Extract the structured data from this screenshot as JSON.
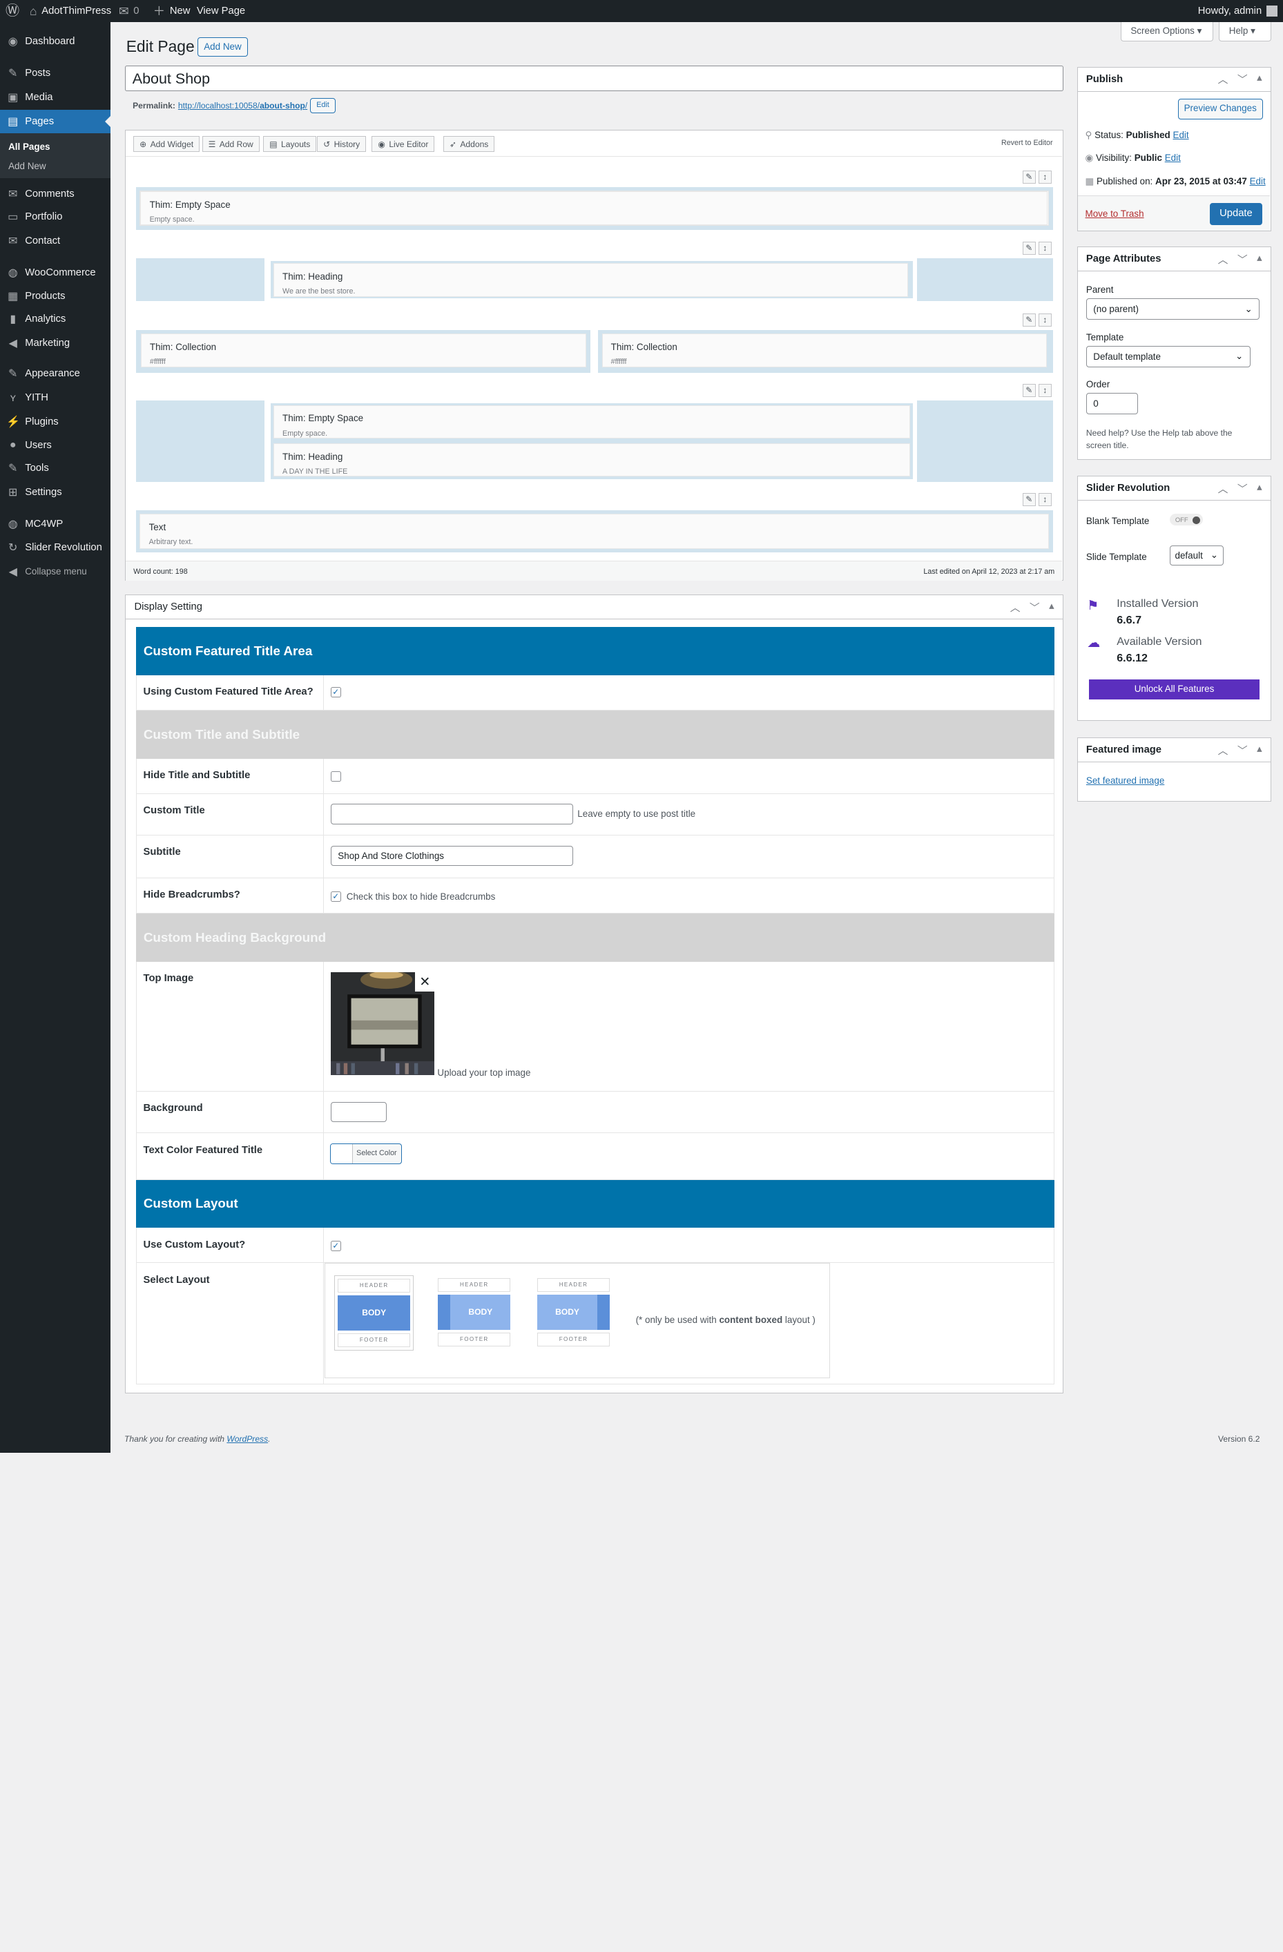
{
  "adminbar": {
    "site": "AdotThimPress",
    "comments": "0",
    "new": "New",
    "view": "View Page",
    "howdy": "Howdy, admin"
  },
  "menu": {
    "items": [
      {
        "label": "Dashboard",
        "icon": "dashboard-icon",
        "glyph": "◉"
      },
      {
        "label": "Posts",
        "icon": "pin-icon",
        "glyph": "✎"
      },
      {
        "label": "Media",
        "icon": "media-icon",
        "glyph": "▣"
      },
      {
        "label": "Pages",
        "icon": "page-icon",
        "glyph": "▤"
      },
      {
        "label": "Comments",
        "icon": "comment-icon",
        "glyph": "✉"
      },
      {
        "label": "Portfolio",
        "icon": "folder-icon",
        "glyph": "▭"
      },
      {
        "label": "Contact",
        "icon": "mail-icon",
        "glyph": "✉"
      },
      {
        "label": "WooCommerce",
        "icon": "woo-icon",
        "glyph": "◍"
      },
      {
        "label": "Products",
        "icon": "archive-icon",
        "glyph": "▦"
      },
      {
        "label": "Analytics",
        "icon": "chart-bar-icon",
        "glyph": "▮"
      },
      {
        "label": "Marketing",
        "icon": "megaphone-icon",
        "glyph": "◀"
      },
      {
        "label": "Appearance",
        "icon": "brush-icon",
        "glyph": "✎"
      },
      {
        "label": "YITH",
        "icon": "yith-icon",
        "glyph": "ʏ"
      },
      {
        "label": "Plugins",
        "icon": "plug-icon",
        "glyph": "⚡"
      },
      {
        "label": "Users",
        "icon": "user-icon",
        "glyph": "●"
      },
      {
        "label": "Tools",
        "icon": "wrench-icon",
        "glyph": "✎"
      },
      {
        "label": "Settings",
        "icon": "settings-icon",
        "glyph": "⊞"
      },
      {
        "label": "MC4WP",
        "icon": "mc4wp-icon",
        "glyph": "◍"
      },
      {
        "label": "Slider Revolution",
        "icon": "slider-icon",
        "glyph": "↻"
      },
      {
        "label": "Collapse menu",
        "icon": "collapse-icon",
        "glyph": "◀"
      }
    ],
    "sub": [
      "All Pages",
      "Add New"
    ]
  },
  "top": {
    "screen_options": "Screen Options ▾",
    "help": "Help ▾"
  },
  "page": {
    "heading": "Edit Page",
    "add_new": "Add New",
    "title": "About Shop",
    "permalink_label": "Permalink:",
    "permalink_base": "http://localhost:10058/",
    "permalink_slug": "about-shop",
    "permalink_end": "/",
    "edit": "Edit"
  },
  "builder": {
    "tools": [
      "Add Widget",
      "Add Row",
      "Layouts",
      "History",
      "Live Editor",
      "Addons"
    ],
    "revert": "Revert to Editor",
    "widgets": [
      {
        "title": "Thim: Empty Space",
        "desc": "Empty space."
      },
      {
        "title": "Thim: Heading",
        "desc": "We are the best store."
      },
      {
        "title": "Thim: Collection",
        "desc": "#ffffff"
      },
      {
        "title": "Thim: Collection",
        "desc": "#ffffff"
      },
      {
        "title": "Thim: Empty Space",
        "desc": "Empty space."
      },
      {
        "title": "Thim: Heading",
        "desc": "A DAY IN THE LIFE"
      },
      {
        "title": "Text",
        "desc": "Arbitrary text."
      }
    ],
    "word_count": "Word count: 198",
    "last_edited": "Last edited on April 12, 2023 at 2:17 am"
  },
  "display": {
    "title": "Display Setting",
    "sec1": "Custom Featured Title Area",
    "use_custom": "Using Custom Featured Title Area?",
    "sec2": "Custom Title and Subtitle",
    "hide_title": "Hide Title and Subtitle",
    "custom_title": "Custom Title",
    "custom_title_hint": "Leave empty to use post title",
    "custom_title_value": "",
    "subtitle": "Subtitle",
    "subtitle_value": "Shop And Store Clothings",
    "hide_bc": "Hide Breadcrumbs?",
    "hide_bc_hint": "Check this box to hide Breadcrumbs",
    "sec3": "Custom Heading Background",
    "top_image": "Top Image",
    "upload_hint": "Upload your top image",
    "background": "Background",
    "text_color": "Text Color Featured Title",
    "select_color": "Select Color",
    "sec4": "Custom Layout",
    "use_layout": "Use Custom Layout?",
    "select_layout": "Select Layout",
    "layout_header": "HEADER",
    "layout_body": "BODY",
    "layout_footer": "FOOTER",
    "layout_note_a": "(* only be used with ",
    "layout_note_b": "content boxed",
    "layout_note_c": " layout )"
  },
  "publish": {
    "title": "Publish",
    "preview": "Preview Changes",
    "status_label": "Status: ",
    "status": "Published",
    "visibility_label": "Visibility: ",
    "visibility": "Public",
    "published_label": "Published on: ",
    "published": "Apr 23, 2015 at 03:47",
    "edit": "Edit",
    "trash": "Move to Trash",
    "update": "Update"
  },
  "attrs": {
    "title": "Page Attributes",
    "parent_label": "Parent",
    "parent": "(no parent)",
    "template_label": "Template",
    "template": "Default template",
    "order_label": "Order",
    "order": "0",
    "help": "Need help? Use the Help tab above the screen title."
  },
  "slider": {
    "title": "Slider Revolution",
    "blank_label": "Blank Template",
    "blank_state": "OFF",
    "slide_label": "Slide Template",
    "slide_value": "default",
    "installed_label": "Installed Version",
    "installed": "6.6.7",
    "available_label": "Available Version",
    "available": "6.6.12",
    "unlock": "Unlock All Features"
  },
  "featured": {
    "title": "Featured image",
    "link": "Set featured image"
  },
  "footer": {
    "thanks": "Thank you for creating with ",
    "wp": "WordPress",
    "period": ".",
    "version": "Version 6.2"
  },
  "colors": {
    "admin_dark": "#1d2327",
    "accent": "#2271b1",
    "section_blue": "#0073aa",
    "unlock": "#5b2fbe"
  }
}
